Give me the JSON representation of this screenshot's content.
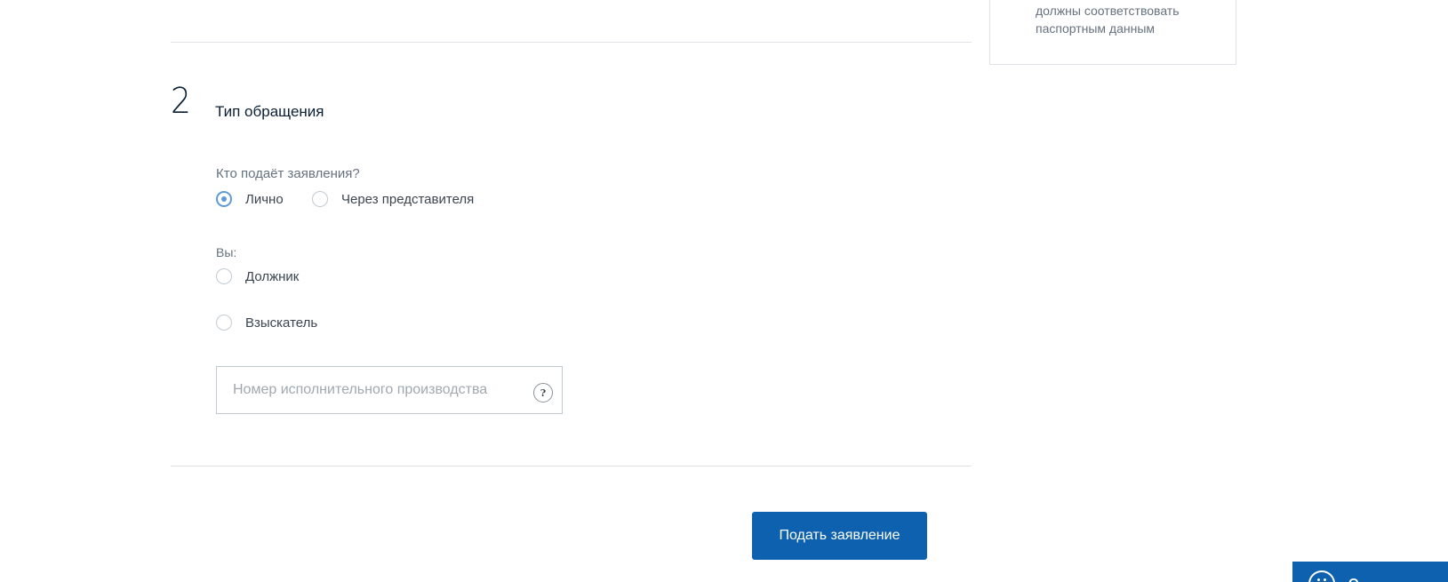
{
  "sidebar_note": {
    "line1": "должны соответствовать",
    "line2": "паспортным данным"
  },
  "step": {
    "number": "2",
    "title": "Тип обращения"
  },
  "who_applies": {
    "label": "Кто подаёт заявления?",
    "options": [
      {
        "label": "Лично",
        "checked": true
      },
      {
        "label": "Через представителя",
        "checked": false
      }
    ]
  },
  "role": {
    "label": "Вы:",
    "options": [
      {
        "label": "Должник",
        "checked": false
      },
      {
        "label": "Взыскатель",
        "checked": false
      }
    ]
  },
  "proceeding_number": {
    "placeholder": "Номер исполнительного производства",
    "value": "",
    "help_icon": "?"
  },
  "submit_label": "Подать заявление",
  "widget": {
    "icon": "chat-bot-icon",
    "text": "О"
  },
  "colors": {
    "primary": "#0d61af",
    "radio_checked": "#5e9bd6"
  }
}
